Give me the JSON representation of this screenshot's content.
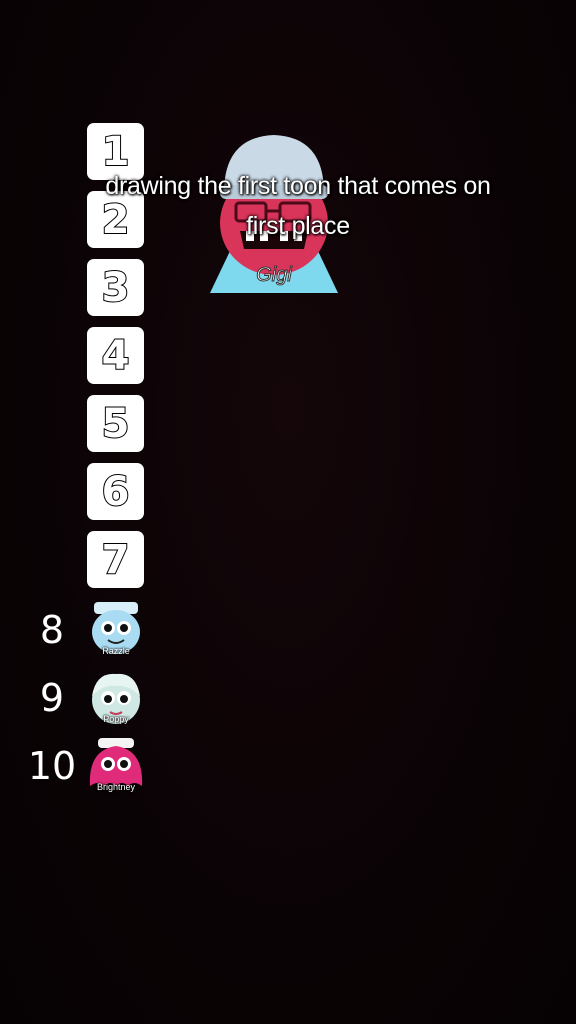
{
  "caption": {
    "line1": "drawing the first toon that comes on",
    "line2": "first place"
  },
  "featured": {
    "name": "Gigi",
    "icon": "gigi-character"
  },
  "ranks_blank": [
    "1",
    "2",
    "3",
    "4",
    "5",
    "6",
    "7"
  ],
  "ranks_filled": [
    {
      "rank": "8",
      "toon": "Razzle",
      "icon": "astro-character"
    },
    {
      "rank": "9",
      "toon": "Poppy",
      "icon": "poppy-character"
    },
    {
      "rank": "10",
      "toon": "Brightney",
      "icon": "brightney-character"
    }
  ],
  "colors": {
    "background": "#0b0406",
    "box": "#ffffff",
    "gigi_skin": "#d9345a",
    "gigi_hat": "#c8d8e6",
    "gigi_shirt": "#7fd9ee",
    "brightney": "#e02a7a",
    "astro": "#a9dcf2"
  }
}
